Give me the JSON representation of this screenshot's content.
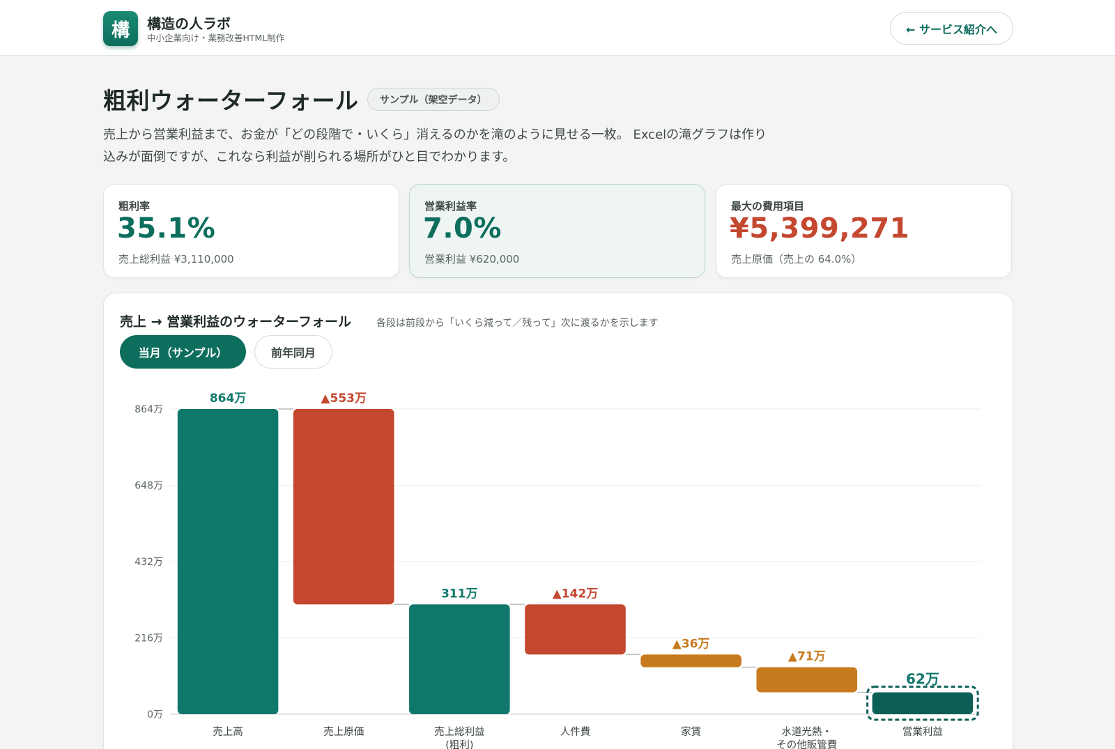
{
  "header": {
    "logo_char": "構",
    "brand_name": "構造の人ラボ",
    "brand_sub": "中小企業向け・業務改善HTML制作",
    "back_label": "← サービス紹介へ"
  },
  "page": {
    "title": "粗利ウォーターフォール",
    "badge": "サンプル（架空データ）",
    "description": "売上から営業利益まで、お金が「どの段階で・いくら」消えるのかを滝のように見せる一枚。 Excelの滝グラフは作り込みが面倒ですが、これなら利益が削られる場所がひと目でわかります。"
  },
  "kpis": [
    {
      "label": "粗利率",
      "value": "35.1%",
      "sub": "売上総利益 ¥3,110,000"
    },
    {
      "label": "営業利益率",
      "value": "7.0%",
      "sub": "営業利益 ¥620,000"
    },
    {
      "label": "最大の費用項目",
      "value": "¥5,399,271",
      "sub": "売上原価（売上の 64.0%）"
    }
  ],
  "chart_section": {
    "title": "売上 → 営業利益のウォーターフォール",
    "note": "各段は前段から「いくら減って／残って」次に渡るかを示します",
    "tabs": [
      "当月（サンプル）",
      "前年同月"
    ]
  },
  "colors": {
    "total": "#10786a",
    "final": "#0c5f55",
    "decrease_major": "#c4472f",
    "decrease_minor": "#c87a1e"
  },
  "chart_data": {
    "type": "bar",
    "subtype": "waterfall",
    "categories": [
      "売上高",
      "売上原価",
      "売上総利益\n(粗利)",
      "人件費",
      "家賃",
      "水道光熱・\nその他販管費",
      "営業利益"
    ],
    "series": [
      {
        "values": [
          864,
          -553,
          311,
          -142,
          -36,
          -71,
          62
        ],
        "kinds": [
          "total",
          "decrease_major",
          "total",
          "decrease_major",
          "decrease_minor",
          "decrease_minor",
          "final"
        ],
        "labels": [
          "864万",
          "▲553万",
          "311万",
          "▲142万",
          "▲36万",
          "▲71万",
          "62万"
        ]
      }
    ],
    "y_ticks": [
      0,
      216,
      432,
      648,
      864
    ],
    "y_tick_labels": [
      "0万",
      "216万",
      "432万",
      "648万",
      "864万"
    ],
    "ylim": [
      0,
      864
    ],
    "grid": true,
    "legend": "none"
  }
}
